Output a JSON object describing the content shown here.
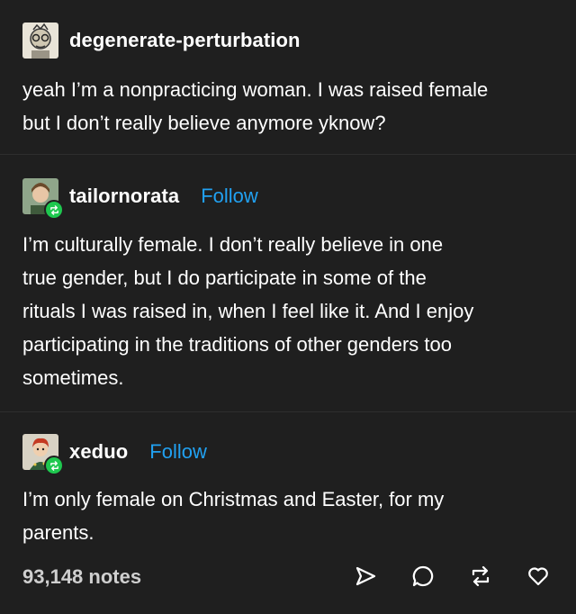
{
  "posts": [
    {
      "username": "degenerate-perturbation",
      "text_lines": [
        "yeah I’m a nonpracticing woman. I was raised female",
        "but I don’t really believe anymore yknow?"
      ]
    },
    {
      "username": "tailornorata",
      "follow": "Follow",
      "text_lines": [
        "I’m culturally female. I don’t really believe in one",
        "true gender, but I do participate in some of the",
        "rituals I was raised in, when I feel like it. And I enjoy",
        "participating in the traditions of other genders too",
        "sometimes."
      ]
    },
    {
      "username": "xeduo",
      "follow": "Follow",
      "text_lines": [
        "I’m only female on Christmas and Easter, for my",
        "parents."
      ]
    }
  ],
  "footer": {
    "notes": "93,148 notes",
    "icons": [
      "share-icon",
      "reply-icon",
      "reblog-icon",
      "like-icon"
    ]
  },
  "colors": {
    "background": "#1f1f1f",
    "follow": "#21a1f1",
    "reblog_badge": "#1ec84f",
    "text": "#ffffff"
  }
}
